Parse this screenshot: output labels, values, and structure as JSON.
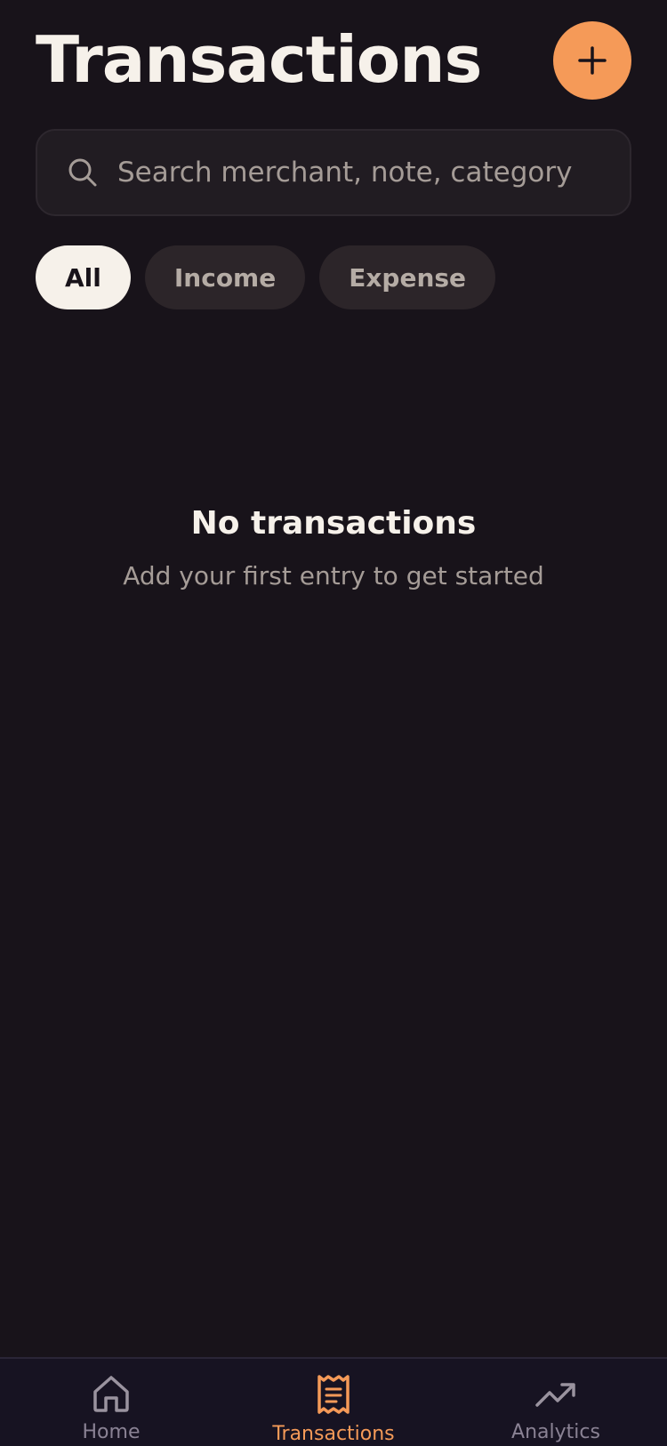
{
  "header": {
    "title": "Transactions",
    "add_icon": "plus-icon"
  },
  "search": {
    "placeholder": "Search merchant, note, category",
    "value": "",
    "icon": "search-icon"
  },
  "filters": [
    {
      "label": "All",
      "active": true
    },
    {
      "label": "Income",
      "active": false
    },
    {
      "label": "Expense",
      "active": false
    }
  ],
  "empty_state": {
    "title": "No transactions",
    "subtitle": "Add your first entry to get started"
  },
  "tabbar": {
    "items": [
      {
        "label": "Home",
        "icon": "home-icon",
        "active": false
      },
      {
        "label": "Transactions",
        "icon": "receipt-icon",
        "active": true
      },
      {
        "label": "Analytics",
        "icon": "trending-up-icon",
        "active": false
      }
    ]
  },
  "colors": {
    "background": "#18131a",
    "accent": "#f59a58",
    "text": "#f6f1ea",
    "muted": "#a59c97",
    "tabbar": "#171322"
  }
}
